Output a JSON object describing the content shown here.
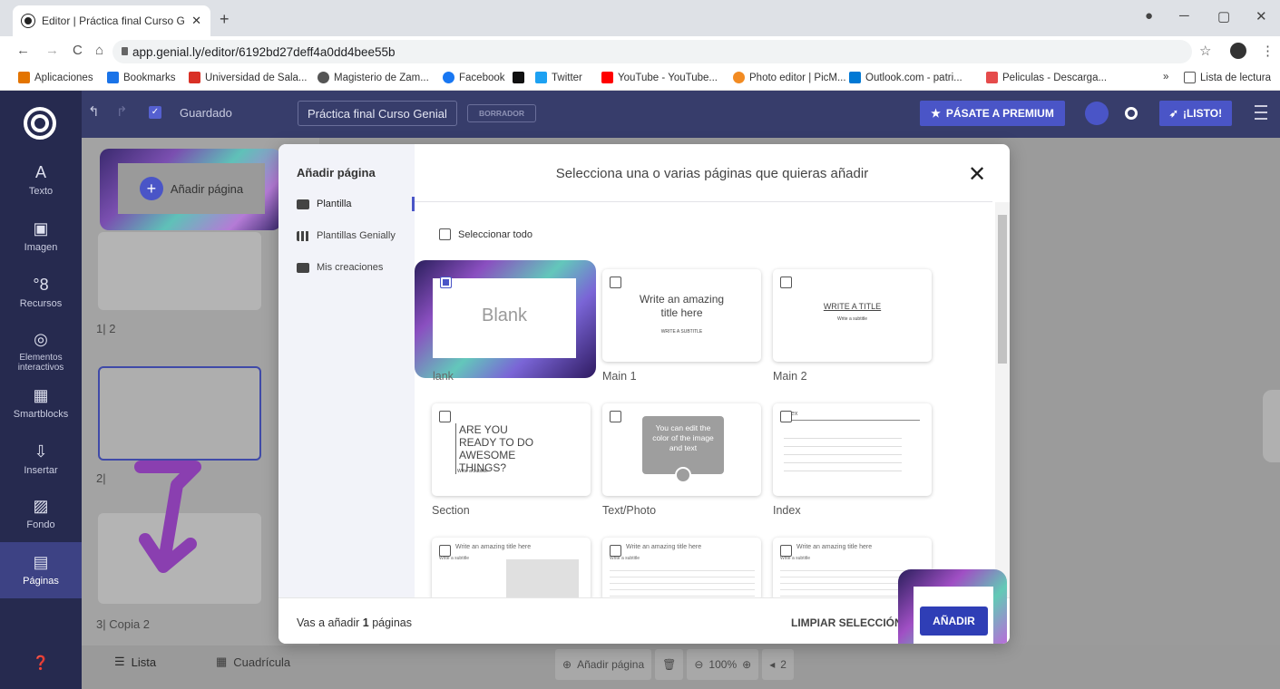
{
  "browser": {
    "tab_title": "Editor | Práctica final Curso Genia",
    "url": "app.genial.ly/editor/6192bd27deff4a0dd4bee55b",
    "bookmarks": [
      {
        "label": "Aplicaciones",
        "color": "#e37400"
      },
      {
        "label": "Bookmarks",
        "color": "#1a73e8"
      },
      {
        "label": "Universidad de Sala...",
        "color": "#d93025"
      },
      {
        "label": "Magisterio de Zam...",
        "color": "#555555"
      },
      {
        "label": "Facebook",
        "color": "#1877f2"
      },
      {
        "label": "",
        "color": "#111111"
      },
      {
        "label": "Twitter",
        "color": "#1da1f2"
      },
      {
        "label": "YouTube - YouTube...",
        "color": "#ff0000"
      },
      {
        "label": "Photo editor | PicM...",
        "color": "#f28b22"
      },
      {
        "label": "Outlook.com - patri...",
        "color": "#0078d4"
      },
      {
        "label": "Peliculas - Descarga...",
        "color": "#e54b4b"
      }
    ],
    "reading_list": "Lista de lectura",
    "more": "»"
  },
  "editor": {
    "saved": "Guardado",
    "title": "Práctica final Curso Genial",
    "draft": "BORRADOR",
    "premium": "PÁSATE A PREMIUM",
    "ready": "¡LISTO!",
    "accent": "#4a55c7"
  },
  "leftnav": [
    {
      "icon": "text-icon",
      "glyph": "A",
      "label": "Texto"
    },
    {
      "icon": "image-icon",
      "glyph": "▣",
      "label": "Imagen"
    },
    {
      "icon": "resources-icon",
      "glyph": "°8",
      "label": "Recursos"
    },
    {
      "icon": "interactive-icon",
      "glyph": "◎",
      "label": "Elementos interactivos"
    },
    {
      "icon": "smartblocks-icon",
      "glyph": "▦",
      "label": "Smartblocks"
    },
    {
      "icon": "insert-icon",
      "glyph": "⇩",
      "label": "Insertar"
    },
    {
      "icon": "background-icon",
      "glyph": "▨",
      "label": "Fondo"
    },
    {
      "icon": "pages-icon",
      "glyph": "▤",
      "label": "Páginas"
    }
  ],
  "pages_panel": {
    "add_page": "Añadir página",
    "page2_label": "1| 2",
    "page3_label": "2|",
    "page4_label": "3| Copia 2",
    "list_tab": "Lista",
    "grid_tab": "Cuadrícula"
  },
  "bottombar": {
    "add_page": "Añadir página",
    "zoom": "100%",
    "page": "2"
  },
  "modal": {
    "sidebar_title": "Añadir página",
    "options": [
      "Plantilla",
      "Plantillas Genially",
      "Mis creaciones"
    ],
    "title": "Selecciona una o varias páginas que quieras añadir",
    "select_all": "Seleccionar todo",
    "cards": [
      {
        "name": "Blank",
        "preview": "Blank",
        "checked": true
      },
      {
        "name": "Main 1",
        "preview": "Write an amazing title here",
        "sub": "WRITE A SUBTITLE",
        "checked": false
      },
      {
        "name": "Main 2",
        "preview": "WRITE A TITLE",
        "sub": "Write a subtitle",
        "checked": false
      },
      {
        "name": "Section",
        "preview": "ARE YOU READY TO DO AWESOME THINGS?",
        "sub": "Write a Subtitle",
        "checked": false
      },
      {
        "name": "Text/Photo",
        "preview": "You can edit the color of the image and text",
        "checked": false
      },
      {
        "name": "Index",
        "preview": "ex",
        "checked": false
      },
      {
        "name": "",
        "preview": "Write an amazing title here",
        "sub": "Write a subtitle",
        "checked": false
      },
      {
        "name": "",
        "preview": "Write an amazing title here",
        "sub": "Write a subtitle",
        "checked": false
      },
      {
        "name": "",
        "preview": "Write an amazing title here",
        "sub": "Write a subtitle",
        "checked": false
      }
    ],
    "footer_prefix": "Vas a añadir",
    "footer_count": "1",
    "footer_suffix": "páginas",
    "clear": "LIMPIAR SELECCIÓN",
    "add": "AÑADIR"
  }
}
